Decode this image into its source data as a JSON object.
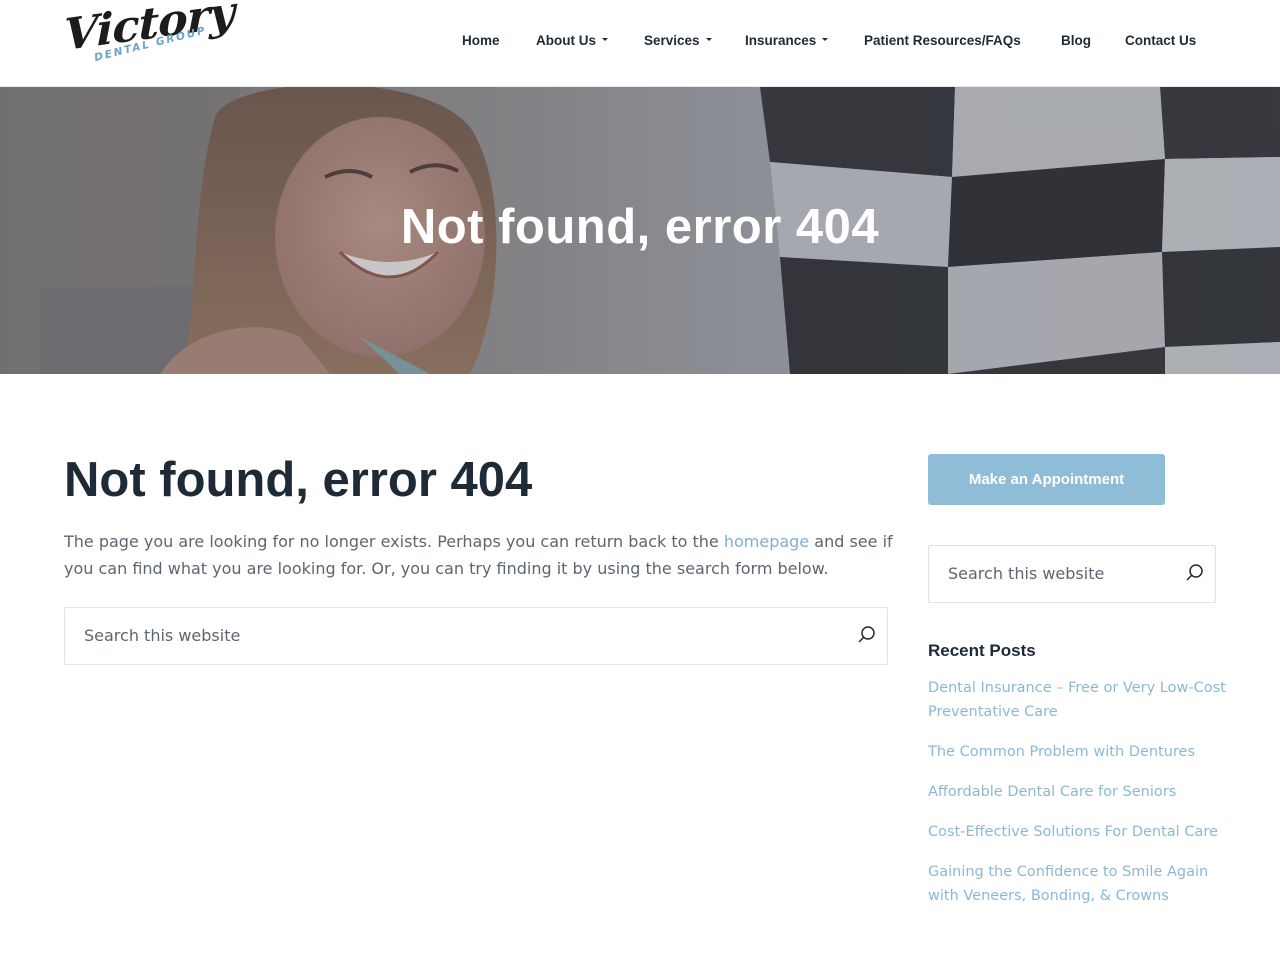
{
  "header": {
    "logo_script": "Victory",
    "logo_sub": "DENTAL GROUP",
    "nav": [
      {
        "label": "Home",
        "dropdown": false
      },
      {
        "label": "About Us",
        "dropdown": true
      },
      {
        "label": "Services",
        "dropdown": true
      },
      {
        "label": "Insurances",
        "dropdown": true
      },
      {
        "label": "Patient Resources/FAQs",
        "dropdown": false
      },
      {
        "label": "Blog",
        "dropdown": false
      },
      {
        "label": "Contact Us",
        "dropdown": false
      }
    ]
  },
  "hero": {
    "title": "Not found, error 404"
  },
  "main": {
    "title": "Not found, error 404",
    "text_before": "The page you are looking for no longer exists. Perhaps you can return back to the ",
    "link": "homepage",
    "text_after": " and see if you can find what you are looking for. Or, you can try finding it by using the search form below.",
    "search_placeholder": "Search this website"
  },
  "sidebar": {
    "appointment_label": "Make an Appointment",
    "search_placeholder": "Search this website",
    "recent_title": "Recent Posts",
    "recent_posts": [
      "Dental Insurance – Free or Very Low-Cost Preventative Care",
      "The Common Problem with Dentures",
      "Affordable Dental Care for Seniors",
      "Cost-Effective Solutions For Dental Care",
      "Gaining the Confidence to Smile Again with Veneers, Bonding, & Crowns"
    ]
  },
  "colors": {
    "accent": "#8fbcd6",
    "link": "#7fb0cf",
    "heading": "#1f2a37",
    "body_text": "#5c6670"
  },
  "icons": {
    "search": "search-icon",
    "caret": "caret-down-icon"
  }
}
